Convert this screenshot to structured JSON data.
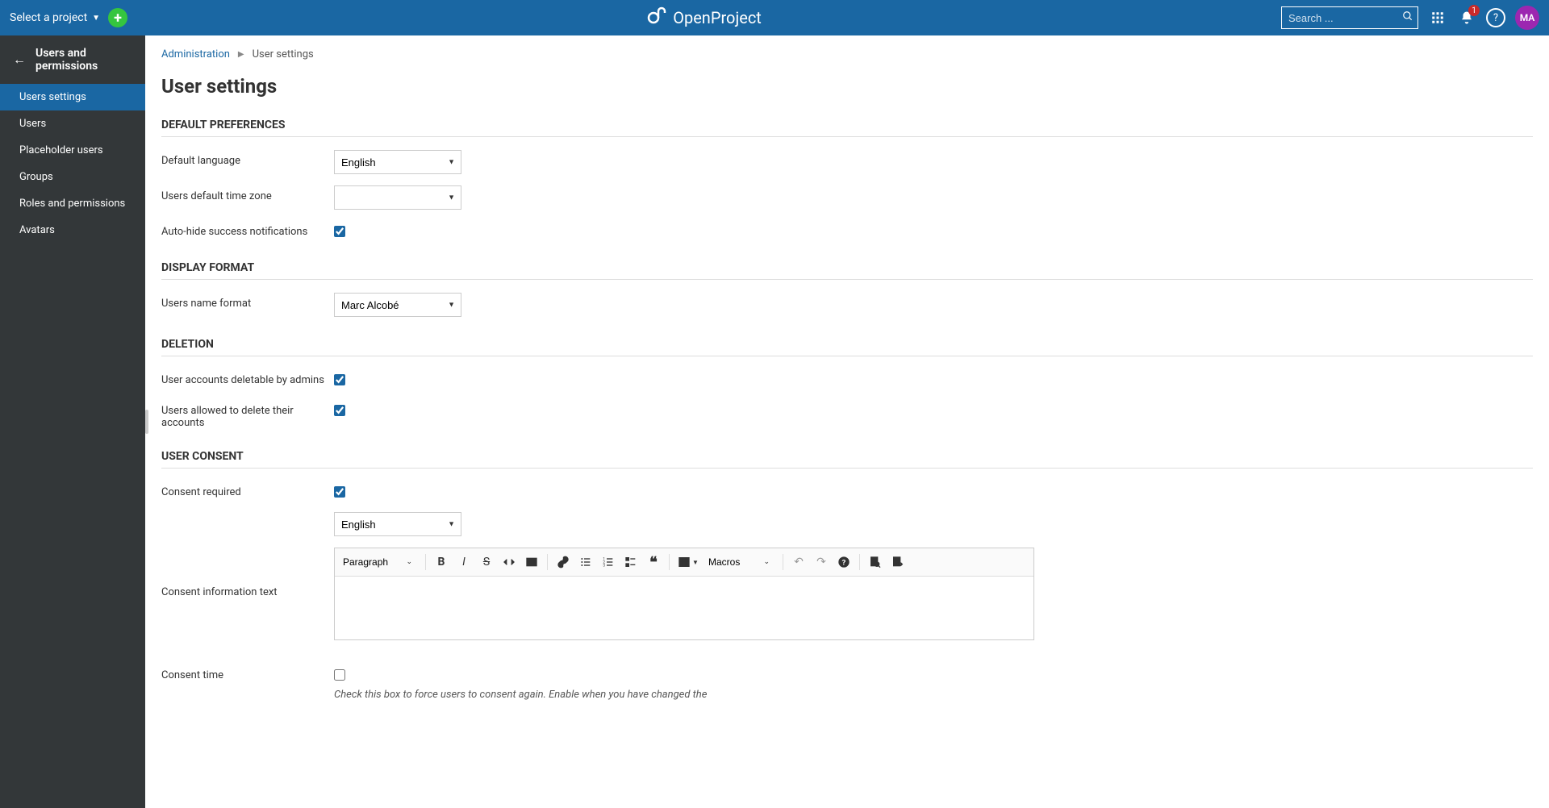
{
  "header": {
    "project_selector": "Select a project",
    "brand": "OpenProject",
    "search_placeholder": "Search ...",
    "notification_count": "1",
    "avatar_initials": "MA"
  },
  "sidebar": {
    "title": "Users and permissions",
    "items": [
      {
        "label": "Users settings",
        "active": true
      },
      {
        "label": "Users",
        "active": false
      },
      {
        "label": "Placeholder users",
        "active": false
      },
      {
        "label": "Groups",
        "active": false
      },
      {
        "label": "Roles and permissions",
        "active": false
      },
      {
        "label": "Avatars",
        "active": false
      }
    ]
  },
  "breadcrumb": {
    "root": "Administration",
    "current": "User settings"
  },
  "page": {
    "title": "User settings"
  },
  "sections": {
    "default_prefs": {
      "heading": "DEFAULT PREFERENCES",
      "default_language_label": "Default language",
      "default_language_value": "English",
      "timezone_label": "Users default time zone",
      "timezone_value": "",
      "autohide_label": "Auto-hide success notifications",
      "autohide_checked": true
    },
    "display_format": {
      "heading": "DISPLAY FORMAT",
      "name_format_label": "Users name format",
      "name_format_value": "Marc Alcobé"
    },
    "deletion": {
      "heading": "DELETION",
      "deletable_admins_label": "User accounts deletable by admins",
      "deletable_admins_checked": true,
      "users_delete_label": "Users allowed to delete their accounts",
      "users_delete_checked": true
    },
    "user_consent": {
      "heading": "USER CONSENT",
      "consent_required_label": "Consent required",
      "consent_required_checked": true,
      "consent_lang_value": "English",
      "consent_info_label": "Consent information text",
      "consent_time_label": "Consent time",
      "consent_time_checked": false,
      "consent_time_help": "Check this box to force users to consent again. Enable when you have changed the"
    }
  },
  "editor": {
    "paragraph_label": "Paragraph",
    "macros_label": "Macros"
  }
}
